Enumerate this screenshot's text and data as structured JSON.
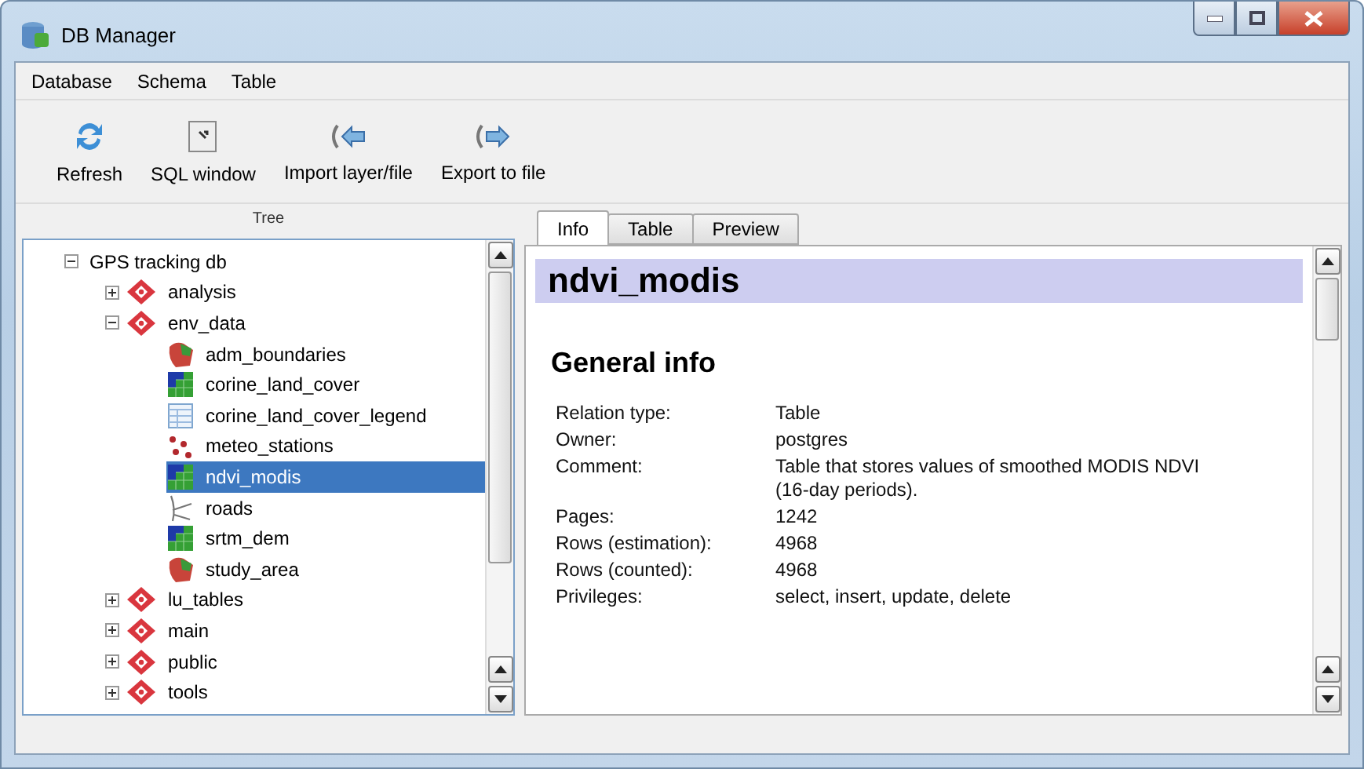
{
  "window": {
    "title": "DB Manager"
  },
  "menu": [
    "Database",
    "Schema",
    "Table"
  ],
  "toolbar": [
    {
      "kind": "refresh",
      "label": "Refresh"
    },
    {
      "kind": "sql",
      "label": "SQL window"
    },
    {
      "kind": "import",
      "label": "Import layer/file"
    },
    {
      "kind": "export",
      "label": "Export to file"
    }
  ],
  "tree": {
    "title": "Tree",
    "items": [
      {
        "label": "GPS tracking db",
        "expanded": true,
        "selected": false,
        "children": [
          {
            "label": "analysis",
            "kind": "schema",
            "expanded": false,
            "selected": false
          },
          {
            "label": "env_data",
            "kind": "schema",
            "expanded": true,
            "selected": false,
            "children": [
              {
                "label": "adm_boundaries",
                "kind": "polygon",
                "selected": false
              },
              {
                "label": "corine_land_cover",
                "kind": "raster",
                "selected": false
              },
              {
                "label": "corine_land_cover_legend",
                "kind": "table",
                "selected": false
              },
              {
                "label": "meteo_stations",
                "kind": "point",
                "selected": false
              },
              {
                "label": "ndvi_modis",
                "kind": "raster",
                "selected": true
              },
              {
                "label": "roads",
                "kind": "line",
                "selected": false
              },
              {
                "label": "srtm_dem",
                "kind": "raster",
                "selected": false
              },
              {
                "label": "study_area",
                "kind": "polygon",
                "selected": false
              }
            ]
          },
          {
            "label": "lu_tables",
            "kind": "schema",
            "expanded": false,
            "selected": false
          },
          {
            "label": "main",
            "kind": "schema",
            "expanded": false,
            "selected": false
          },
          {
            "label": "public",
            "kind": "schema",
            "expanded": false,
            "selected": false
          },
          {
            "label": "tools",
            "kind": "schema",
            "expanded": false,
            "selected": false
          }
        ]
      }
    ]
  },
  "tabs": [
    {
      "label": "Info",
      "selected": true
    },
    {
      "label": "Table",
      "selected": false
    },
    {
      "label": "Preview",
      "selected": false
    }
  ],
  "info": {
    "title": "ndvi_modis",
    "section": "General info",
    "rows": [
      {
        "label": "Relation type:",
        "value": "Table"
      },
      {
        "label": "Owner:",
        "value": "postgres"
      },
      {
        "label": "Comment:",
        "value": "Table that stores values of smoothed MODIS NDVI (16-day periods)."
      },
      {
        "label": "Pages:",
        "value": "1242"
      },
      {
        "label": "Rows (estimation):",
        "value": "4968"
      },
      {
        "label": "Rows (counted):",
        "value": "4968"
      },
      {
        "label": "Privileges:",
        "value": "select, insert, update, delete"
      }
    ]
  }
}
